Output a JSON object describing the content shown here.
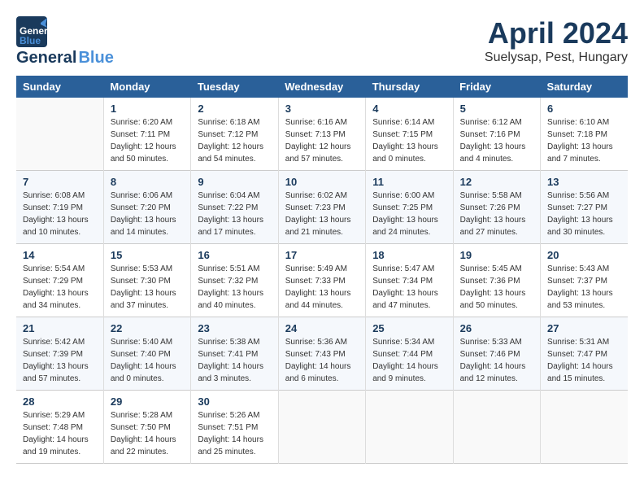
{
  "header": {
    "logo_line1": "General",
    "logo_line2": "Blue",
    "title": "April 2024",
    "subtitle": "Suelysap, Pest, Hungary"
  },
  "weekdays": [
    "Sunday",
    "Monday",
    "Tuesday",
    "Wednesday",
    "Thursday",
    "Friday",
    "Saturday"
  ],
  "weeks": [
    [
      {
        "day": "",
        "info": ""
      },
      {
        "day": "1",
        "info": "Sunrise: 6:20 AM\nSunset: 7:11 PM\nDaylight: 12 hours\nand 50 minutes."
      },
      {
        "day": "2",
        "info": "Sunrise: 6:18 AM\nSunset: 7:12 PM\nDaylight: 12 hours\nand 54 minutes."
      },
      {
        "day": "3",
        "info": "Sunrise: 6:16 AM\nSunset: 7:13 PM\nDaylight: 12 hours\nand 57 minutes."
      },
      {
        "day": "4",
        "info": "Sunrise: 6:14 AM\nSunset: 7:15 PM\nDaylight: 13 hours\nand 0 minutes."
      },
      {
        "day": "5",
        "info": "Sunrise: 6:12 AM\nSunset: 7:16 PM\nDaylight: 13 hours\nand 4 minutes."
      },
      {
        "day": "6",
        "info": "Sunrise: 6:10 AM\nSunset: 7:18 PM\nDaylight: 13 hours\nand 7 minutes."
      }
    ],
    [
      {
        "day": "7",
        "info": "Sunrise: 6:08 AM\nSunset: 7:19 PM\nDaylight: 13 hours\nand 10 minutes."
      },
      {
        "day": "8",
        "info": "Sunrise: 6:06 AM\nSunset: 7:20 PM\nDaylight: 13 hours\nand 14 minutes."
      },
      {
        "day": "9",
        "info": "Sunrise: 6:04 AM\nSunset: 7:22 PM\nDaylight: 13 hours\nand 17 minutes."
      },
      {
        "day": "10",
        "info": "Sunrise: 6:02 AM\nSunset: 7:23 PM\nDaylight: 13 hours\nand 21 minutes."
      },
      {
        "day": "11",
        "info": "Sunrise: 6:00 AM\nSunset: 7:25 PM\nDaylight: 13 hours\nand 24 minutes."
      },
      {
        "day": "12",
        "info": "Sunrise: 5:58 AM\nSunset: 7:26 PM\nDaylight: 13 hours\nand 27 minutes."
      },
      {
        "day": "13",
        "info": "Sunrise: 5:56 AM\nSunset: 7:27 PM\nDaylight: 13 hours\nand 30 minutes."
      }
    ],
    [
      {
        "day": "14",
        "info": "Sunrise: 5:54 AM\nSunset: 7:29 PM\nDaylight: 13 hours\nand 34 minutes."
      },
      {
        "day": "15",
        "info": "Sunrise: 5:53 AM\nSunset: 7:30 PM\nDaylight: 13 hours\nand 37 minutes."
      },
      {
        "day": "16",
        "info": "Sunrise: 5:51 AM\nSunset: 7:32 PM\nDaylight: 13 hours\nand 40 minutes."
      },
      {
        "day": "17",
        "info": "Sunrise: 5:49 AM\nSunset: 7:33 PM\nDaylight: 13 hours\nand 44 minutes."
      },
      {
        "day": "18",
        "info": "Sunrise: 5:47 AM\nSunset: 7:34 PM\nDaylight: 13 hours\nand 47 minutes."
      },
      {
        "day": "19",
        "info": "Sunrise: 5:45 AM\nSunset: 7:36 PM\nDaylight: 13 hours\nand 50 minutes."
      },
      {
        "day": "20",
        "info": "Sunrise: 5:43 AM\nSunset: 7:37 PM\nDaylight: 13 hours\nand 53 minutes."
      }
    ],
    [
      {
        "day": "21",
        "info": "Sunrise: 5:42 AM\nSunset: 7:39 PM\nDaylight: 13 hours\nand 57 minutes."
      },
      {
        "day": "22",
        "info": "Sunrise: 5:40 AM\nSunset: 7:40 PM\nDaylight: 14 hours\nand 0 minutes."
      },
      {
        "day": "23",
        "info": "Sunrise: 5:38 AM\nSunset: 7:41 PM\nDaylight: 14 hours\nand 3 minutes."
      },
      {
        "day": "24",
        "info": "Sunrise: 5:36 AM\nSunset: 7:43 PM\nDaylight: 14 hours\nand 6 minutes."
      },
      {
        "day": "25",
        "info": "Sunrise: 5:34 AM\nSunset: 7:44 PM\nDaylight: 14 hours\nand 9 minutes."
      },
      {
        "day": "26",
        "info": "Sunrise: 5:33 AM\nSunset: 7:46 PM\nDaylight: 14 hours\nand 12 minutes."
      },
      {
        "day": "27",
        "info": "Sunrise: 5:31 AM\nSunset: 7:47 PM\nDaylight: 14 hours\nand 15 minutes."
      }
    ],
    [
      {
        "day": "28",
        "info": "Sunrise: 5:29 AM\nSunset: 7:48 PM\nDaylight: 14 hours\nand 19 minutes."
      },
      {
        "day": "29",
        "info": "Sunrise: 5:28 AM\nSunset: 7:50 PM\nDaylight: 14 hours\nand 22 minutes."
      },
      {
        "day": "30",
        "info": "Sunrise: 5:26 AM\nSunset: 7:51 PM\nDaylight: 14 hours\nand 25 minutes."
      },
      {
        "day": "",
        "info": ""
      },
      {
        "day": "",
        "info": ""
      },
      {
        "day": "",
        "info": ""
      },
      {
        "day": "",
        "info": ""
      }
    ]
  ]
}
